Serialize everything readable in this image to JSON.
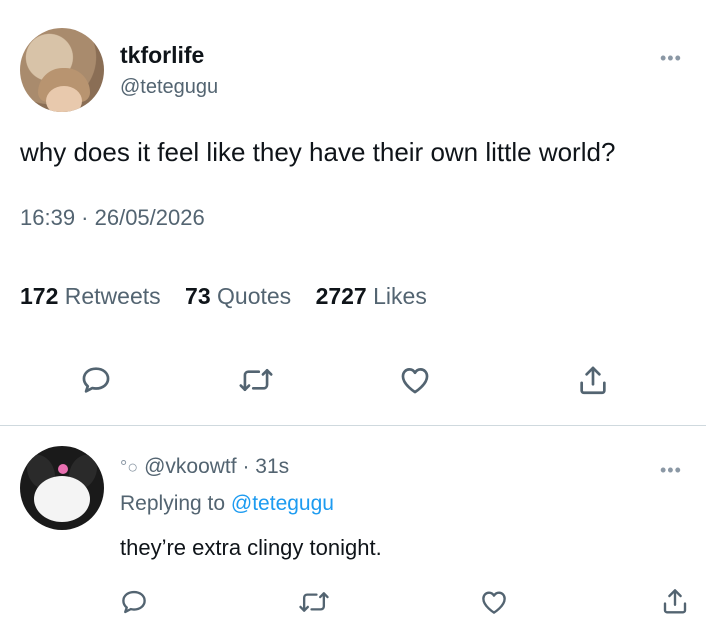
{
  "tweet": {
    "display_name": "tkforlife",
    "handle": "@tetegugu",
    "text": "why does it feel like they have their own little world?",
    "timestamp": "16:39 · 26/05/2026",
    "stats": {
      "retweets_count": "172",
      "retweets_label": "Retweets",
      "quotes_count": "73",
      "quotes_label": "Quotes",
      "likes_count": "2727",
      "likes_label": "Likes"
    },
    "more_glyph": "•••"
  },
  "reply": {
    "handle": "@vkoowtf",
    "separator": "·",
    "time": "31s",
    "replying_to_label": "Replying to",
    "replying_to_handle": "@tetegugu",
    "text": "they’re extra clingy tonight.",
    "more_glyph": "•••",
    "bubbles_glyph": "°○"
  },
  "icons": {
    "reply": "comment-icon",
    "retweet": "retweet-icon",
    "like": "heart-icon",
    "share": "share-icon",
    "more": "more-icon"
  },
  "colors": {
    "text": "#0f1419",
    "secondary": "#536471",
    "link": "#1d9bf0",
    "divider": "#cfd9de"
  }
}
